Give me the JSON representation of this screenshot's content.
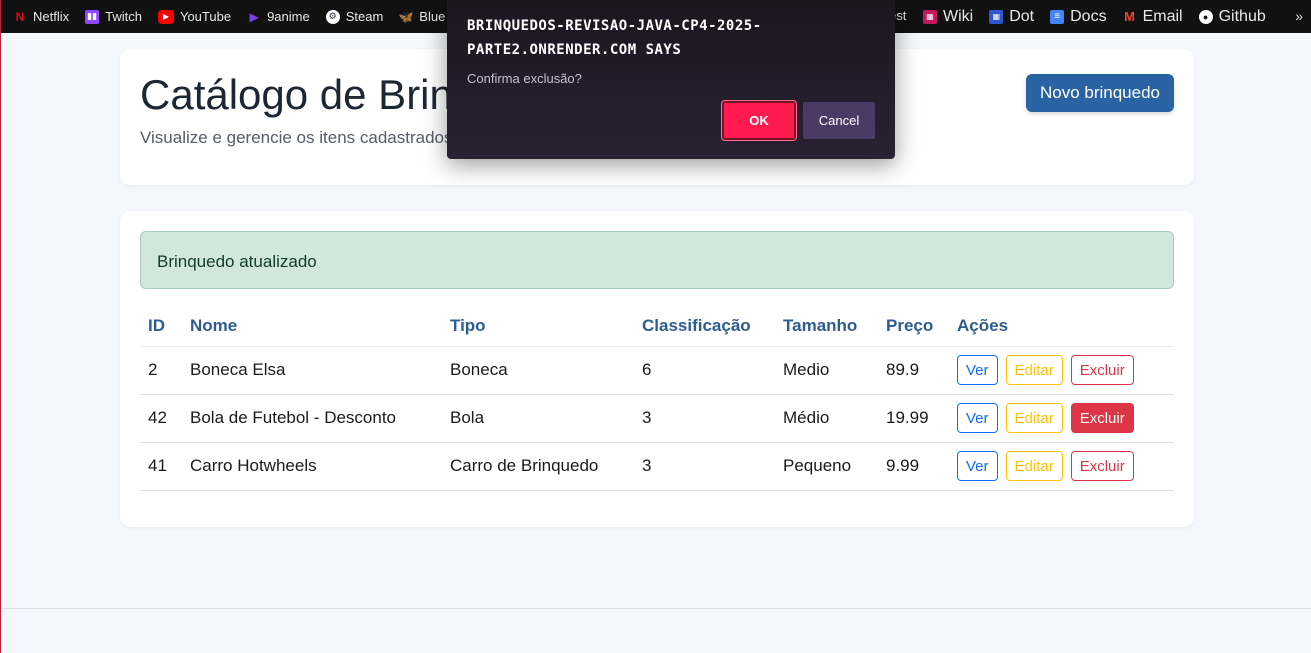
{
  "bookmarks": [
    {
      "label": "Netflix",
      "icon": "netflix-icon",
      "color": "#e50914"
    },
    {
      "label": "Twitch",
      "icon": "twitch-icon",
      "color": "#9146ff"
    },
    {
      "label": "YouTube",
      "icon": "youtube-icon",
      "color": "#ff0000"
    },
    {
      "label": "9anime",
      "icon": "9anime-icon",
      "color": "#7b3fe4"
    },
    {
      "label": "Steam",
      "icon": "steam-icon",
      "color": "#66c0f4"
    },
    {
      "label": "Blue",
      "icon": "bluesky-icon",
      "color": "#1185fe"
    }
  ],
  "bookmarks_partial": "est",
  "bookmarks_right": [
    {
      "label": "Wiki",
      "icon": "wiki-icon",
      "color": "#c2185b"
    },
    {
      "label": "Dot",
      "icon": "dot-icon",
      "color": "#3355cc"
    },
    {
      "label": "Docs",
      "icon": "docs-icon",
      "color": "#4285f4"
    },
    {
      "label": "Email",
      "icon": "gmail-icon",
      "color": "#ea4335"
    },
    {
      "label": "Github",
      "icon": "github-icon",
      "color": "#ffffff"
    }
  ],
  "bookmarks_overflow": "»",
  "header": {
    "title": "Catálogo de Brin",
    "subtitle": "Visualize e gerencie os itens cadastrados",
    "new_button": "Novo brinquedo"
  },
  "alert": "Brinquedo atualizado",
  "table": {
    "columns": [
      "ID",
      "Nome",
      "Tipo",
      "Classificação",
      "Tamanho",
      "Preço",
      "Ações"
    ],
    "rows": [
      {
        "id": "2",
        "nome": "Boneca Elsa",
        "tipo": "Boneca",
        "classificacao": "6",
        "tamanho": "Medio",
        "preco": "89.9"
      },
      {
        "id": "42",
        "nome": "Bola de Futebol - Desconto",
        "tipo": "Bola",
        "classificacao": "3",
        "tamanho": "Médio",
        "preco": "19.99"
      },
      {
        "id": "41",
        "nome": "Carro Hotwheels",
        "tipo": "Carro de Brinquedo",
        "classificacao": "3",
        "tamanho": "Pequeno",
        "preco": "9.99"
      }
    ],
    "actions": {
      "view": "Ver",
      "edit": "Editar",
      "delete": "Excluir"
    }
  },
  "dialog": {
    "title": "brinquedos-revisao-java-cp4-2025-parte2.onrender.com says",
    "message": "Confirma exclusão?",
    "ok": "OK",
    "cancel": "Cancel"
  },
  "colors": {
    "primary": "#2a63a4",
    "alert_bg": "#d1e7dd",
    "danger": "#dc3545",
    "warning": "#ffc107",
    "info": "#0d6efd",
    "dialog_ok": "#ff1a4f"
  }
}
